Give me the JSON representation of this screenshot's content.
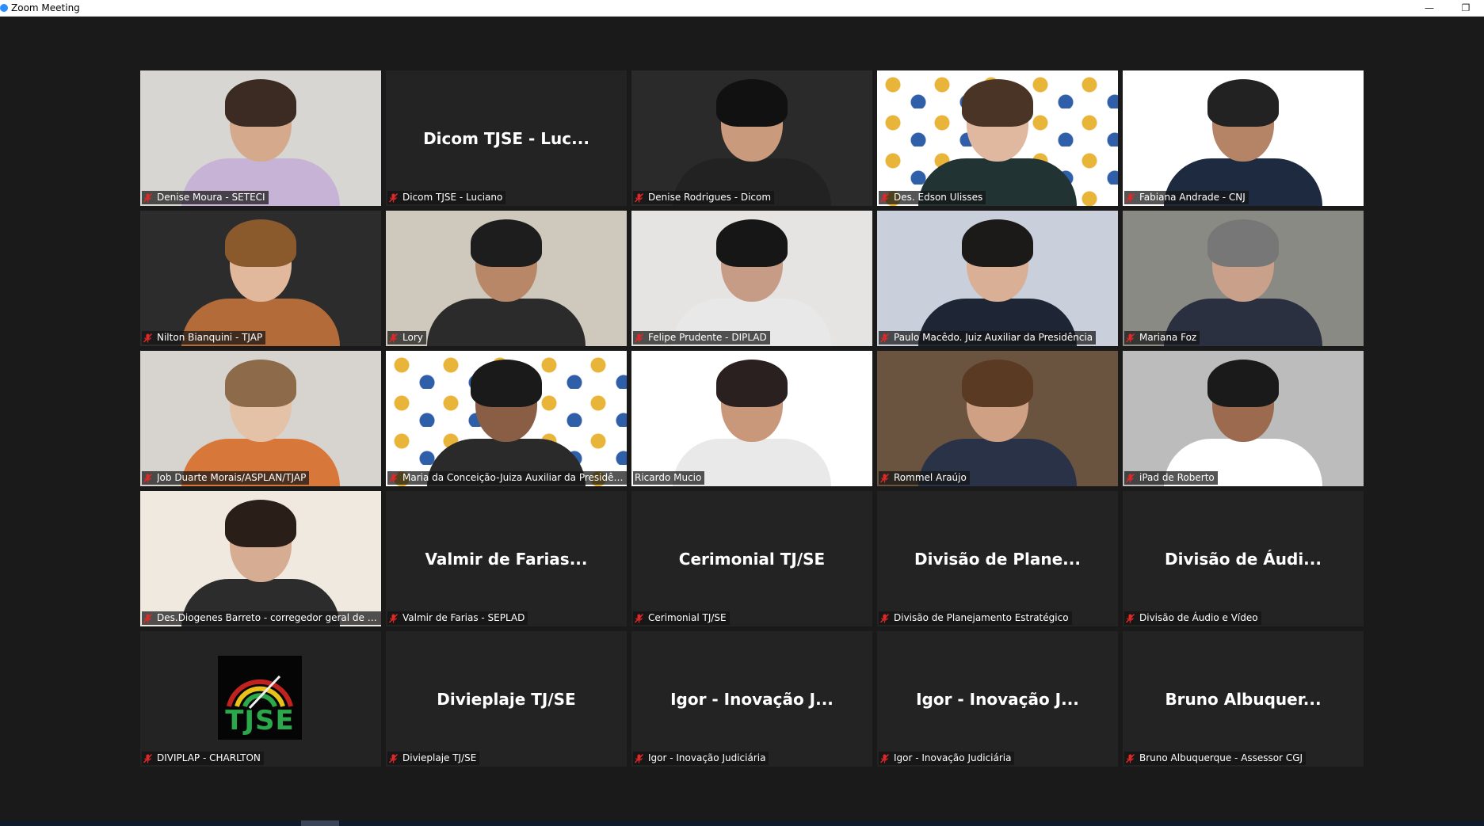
{
  "window": {
    "title": "Zoom Meeting",
    "minimize_glyph": "—",
    "restore_glyph": "❐"
  },
  "participants": [
    {
      "label": "Denise Moura - SETECI",
      "video": true,
      "muted": true
    },
    {
      "label": "Dicom TJSE - Luciano",
      "center_name": "Dicom TJSE - Luc...",
      "video": false,
      "muted": true
    },
    {
      "label": "Denise Rodrigues - Dicom",
      "video": true,
      "muted": true
    },
    {
      "label": "Des. Edson Ulisses",
      "video": true,
      "muted": true
    },
    {
      "label": "Fabiana Andrade - CNJ",
      "video": true,
      "muted": true
    },
    {
      "label": "Nilton Bianquini - TJAP",
      "video": true,
      "muted": true
    },
    {
      "label": "Lory",
      "video": true,
      "muted": true
    },
    {
      "label": "Felipe Prudente - DIPLAD",
      "video": true,
      "muted": true
    },
    {
      "label": "Paulo Macêdo. Juiz Auxiliar da Presidência",
      "video": true,
      "muted": true
    },
    {
      "label": "Mariana Foz",
      "video": true,
      "muted": true
    },
    {
      "label": "Job Duarte Morais/ASPLAN/TJAP",
      "video": true,
      "muted": true
    },
    {
      "label": "Maria da Conceição-Juiza Auxiliar da Presidên...",
      "video": true,
      "muted": true
    },
    {
      "label": "Ricardo Mucio",
      "video": true,
      "muted": false,
      "active_speaker": true
    },
    {
      "label": "Rommel Araújo",
      "video": true,
      "muted": true
    },
    {
      "label": "iPad de Roberto",
      "video": true,
      "muted": true
    },
    {
      "label": "Des.Diogenes Barreto - corregedor geral de J...",
      "video": true,
      "muted": true
    },
    {
      "label": "Valmir de Farias - SEPLAD",
      "center_name": "Valmir de Farias...",
      "video": false,
      "muted": true
    },
    {
      "label": "Cerimonial TJ/SE",
      "center_name": "Cerimonial TJ/SE",
      "video": false,
      "muted": true
    },
    {
      "label": "Divisão de Planejamento Estratégico",
      "center_name": "Divisão de Plane...",
      "video": false,
      "muted": true
    },
    {
      "label": "Divisão de Áudio e Vídeo",
      "center_name": "Divisão de Áudi...",
      "video": false,
      "muted": true
    },
    {
      "label": "DIVIPLAP - CHARLTON",
      "logo_text": "TJSE",
      "video": false,
      "muted": true
    },
    {
      "label": "Divieplaje TJ/SE",
      "center_name": "Divieplaje TJ/SE",
      "video": false,
      "muted": true
    },
    {
      "label": "Igor - Inovação Judiciária",
      "center_name": "Igor - Inovação J...",
      "video": false,
      "muted": true
    },
    {
      "label": "Igor - Inovação Judiciária",
      "center_name": "Igor - Inovação J...",
      "video": false,
      "muted": true
    },
    {
      "label": "Bruno Albuquerque - Assessor CGJ",
      "center_name": "Bruno  Albuquer...",
      "video": false,
      "muted": true
    }
  ],
  "colors": {
    "active_speaker_border": "#b8e65a",
    "muted_icon": "#e02828",
    "background": "#1a1a1a"
  }
}
